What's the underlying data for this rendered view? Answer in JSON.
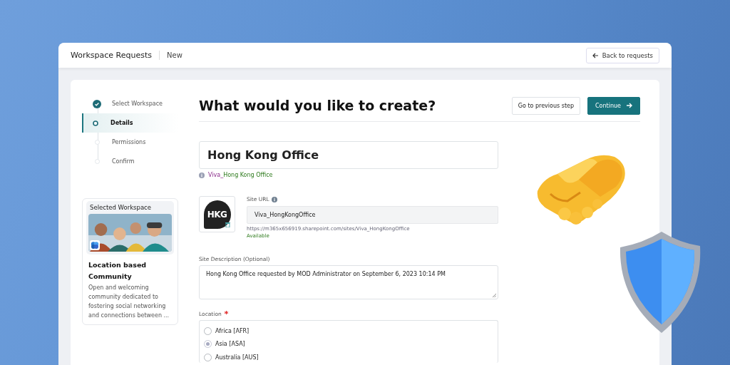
{
  "header": {
    "title": "Workspace Requests",
    "subtitle": "New",
    "back_button": "Back to requests"
  },
  "steps": [
    {
      "label": "Select Workspace",
      "kind": "done",
      "selected": false
    },
    {
      "label": "Details",
      "kind": "current",
      "selected": true
    },
    {
      "label": "Permissions",
      "kind": "todo",
      "selected": false
    },
    {
      "label": "Confirm",
      "kind": "todo",
      "selected": false
    }
  ],
  "selected_workspace": {
    "heading": "Selected Workspace",
    "name": "Location based Community",
    "description": "Open and welcoming community dedicated to fostering social networking and connections between ..."
  },
  "page": {
    "title": "What would you like to create?",
    "buttons": [
      {
        "label": "Go to previous step",
        "kind": "secondary"
      },
      {
        "label": "Continue",
        "kind": "primary"
      }
    ]
  },
  "form": {
    "name_value": "Hong Kong Office",
    "name_hint_prefix": "Viva_",
    "name_hint_name": "Hong Kong Office",
    "logo_text": "HKG",
    "site_url_label": "Site URL",
    "site_url_value": "Viva_HongKongOffice",
    "site_url_full": "https://m365x656919.sharepoint.com/sites/Viva_HongKongOffice",
    "availability": "Available",
    "description_label": "Site Description (Optional)",
    "description_value": "Hong Kong Office requested by MOD Administrator on September 6, 2023 10:14 PM",
    "location_label": "Location",
    "location_required": true,
    "location_options": [
      {
        "label": "Africa [AFR]",
        "selected": false
      },
      {
        "label": "Asia [ASA]",
        "selected": true
      },
      {
        "label": "Australia [AUS]",
        "selected": false
      }
    ]
  }
}
